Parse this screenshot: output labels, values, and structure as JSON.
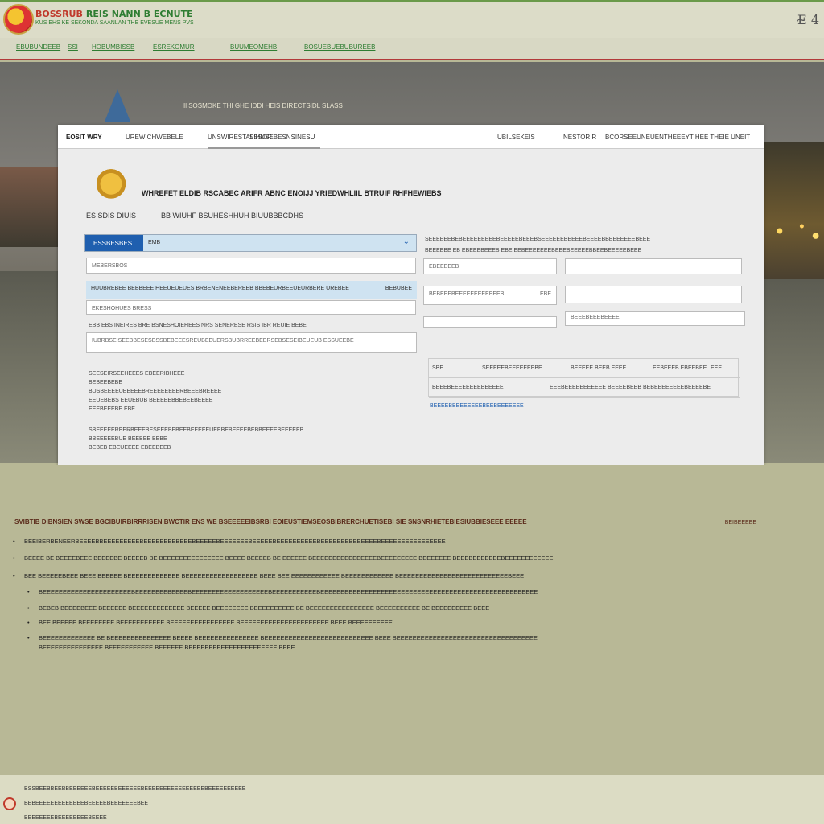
{
  "header": {
    "brand_title_1": "BOSSRUB",
    "brand_title_2": "REIS NANN B ECNUTE",
    "brand_subtitle": "KUS EHS KE SEKONDA SAANLAN THE EVESUE MENS PVS",
    "language_label": "E̴ 4"
  },
  "nav": {
    "items": [
      {
        "label": "EBUBUNDEEB"
      },
      {
        "label": "SSI"
      },
      {
        "label": "HOBUMBISSB"
      },
      {
        "label": "ESREKOMUR"
      },
      {
        "label": "BUUMEOMEHB"
      },
      {
        "label": "BOSUEBUEBUBUREEB"
      }
    ]
  },
  "hero": {
    "caption": "Il SOSMOKE THI GHE IDDI HEIS DIRECTSIDL SLASS"
  },
  "panel": {
    "tabs": [
      {
        "label": "EOSIT WRY"
      },
      {
        "label": "UREWICHWEBELE"
      },
      {
        "label": "UNSWIRESTALSSOR"
      },
      {
        "label": "SIHUSEBESNSINESU"
      },
      {
        "label": "UBILSEKEIS"
      },
      {
        "label": "NESTORIR"
      },
      {
        "label": "BCORSEEUNEUENTHEEEYT HEE THEIE UNEIT"
      }
    ],
    "form_title": "WHREFET ELDIB RSCABEC ARIFR ABNC ENOIJJ YRIEDWHLIIL BTRUIF RHFHEWIEBS",
    "form_ref_1": "ES SDIS DIUIS",
    "form_ref_2": "BB WIUHF BSUHESHHUH BIUUBBBCDHS",
    "select": {
      "tag": "ESSBESBES",
      "value": "EMB",
      "chevron": "⌄"
    },
    "left_input_1": "MEBERSBOS",
    "row_band": "HUUBREBEE BEBBEEE HEEUEUEUES BRBENENEEBEREEB BBEBEURBEEUEURBERE UREBEE",
    "row_band_right": "BEBUBEE",
    "left_input_2": "EKESHOHUES BRESS",
    "note_line": "EBB EBS INEIRES BRE BSNESHOIEHEES NRS SENERESE RSIS IBR REUIE BEBE",
    "left_textarea": "IUBRBSEISEEBBESESESSBEBEEESREUBEEUERSBUBRREEBEERSEBSESEIBEUEUB ESSUEEBE",
    "left_info_1": "SEESEIRSEEHEEES EBEERIBHEEE",
    "left_info_2": "BEBEEBEBE",
    "left_info_3": "BUSBEEEEUEEEEEBREEEEEEEERBEEEBREEEE",
    "left_info_4": "EEUEBEBS EEUEBUB BEEEEEBBEBEEBEEEE",
    "left_info_5": "EEEBEEEBE   EBE",
    "left_footnote_1": "SBEEEEEREERBEEEBESEEEBEBEEBEEEEEUEEBEBEEEEBEBBEEEEBEEEEEB",
    "left_footnote_2": "BBEEEEEBUE BEEBEE BEBE",
    "left_footnote_3": "BEBEB EBEUEEEE EBEEBEEB",
    "right_header": "SEEEEEEBEBEEEEEEEEEBEEEEEBEEEBSEEEEEEBEEEEBEEEEBBEEEEEEEBEEE",
    "right_label_1": "BEEEEBE EB EBEEEBEEEB EBE EEBEEEEEEEBEEEBEEEEEBBEEBEEEEEBEEE",
    "right_input_1": "EBEEEEEB",
    "right_input_2": "",
    "right_input_3": "BEBEEEBEEEEEEEEEEEEB",
    "right_input_3b": "EBE",
    "right_input_4": "",
    "right_input_5": "",
    "right_input_6": "BEEEBEEEBEEEE",
    "table": {
      "rows": [
        {
          "c1": "SBE",
          "c2": "SEEEEEBEEEEEEEBE",
          "c3": "BEEEEE BEEB EEEE",
          "c4": "EEBEEEB   EBEEBEE",
          "c5": "EEE"
        },
        {
          "c1": "BEEEBEEEEEEEEBEEEEE",
          "c2": "",
          "c3": "EEEBEEEEEEEEEEE BEEEEBEEB BEBEEEEEEEEBEEEEBE",
          "c4": "",
          "c5": ""
        }
      ]
    },
    "right_link": "BEEEEBBEEEEEEEBEEBEEEEEEE"
  },
  "content": {
    "section_title": "SVIBTIB DIBNSIEN SWSE BGCIBUIRBIRRRISEN BWCTIR ENS WE BSEEEEEIBSRBI EOIEUSTIEMSEOSBIBRERCHUETISEBI SIE SNSNRHIETEBIESIUBBIESEEE EEEEE",
    "section_right": "BEIBEEEEE",
    "bullets": [
      "BEEIBERBENEERBEEEEBBEEEEEEEEEBEEEEEEEEBEEEBEEEEEBEEEEEEEBEEEEEBEEEEEEEEEEBEEEEEEEBEEEEEEBEEEEEEEEEEEEEEEE",
      "BEEEE BE BEEEEBEEE BEEEEBE BEEEEB BE BEEEEEEEEEEEEEEE BEEEE BEEEEB BE EEEEEE BEEEEEEEEEEEEEEEEBEEEEEEEEE BEEEEEEE BEEEBEEEEEEEBEEEEEEEEEEEE",
      "BEE BEEEEEBEEE BEEE BEEEEE BEEEEEEEEEEEEE BEEEEEEEEEEEEEEEEEE BEEE BEE EEEEEEEEEEEE BEEEEEEEEEEEE BEEEEEEEEEEEEEEEEEEEEEEEEEEEBEEE",
      "BEEEEEEEEEEEEEEEEEEEEEEBEEEEEEEEBEEEEBEEEEEEEEEEEEEEEEEEEBEEEEEEEEEEEBEEEEEEEEEEEEEEEEEEEEEEEEEEEEEEEEEEEEEEEEEEEEEEEEEEEEEE",
      "BEBEB BEEEEBEEE BEEEEEE BEEEEEEEEEEEEE BEEEEE BEEEEEEEE BEEEEEEEEEE BE BEEEEEEEEEEEEEEEE BEEEEEEEEEE BE BEEEEEEEEE BEEE",
      "BEE BEEEEE BEEEEEEEE BEEEEEEEEEEE BEEEEEEEEEEEEEEEE BEEEEEEEEEEEEEEEEEEEEEE BEEE BEEEEEEEEEE",
      "BEEEEEEEEEEEEE BE BEEEEEEEEEEEEEEE BEEEE BEEEEEEEEEEEEEEE BEEEEEEEEEEEEEEEEEEEEEEEEEEE BEEE BEEEEEEEEEEEEEEEEEEEEEEEEEEEEEEEEEEE",
      "BEEEEEEEEEEEEEEE BEEEEEEEEEEE BEEEEEE BEEEEEEEEEEEEEEEEEEEEEE BEEE"
    ]
  },
  "footer": {
    "line_1": "BSSBEEBBEEBBEEEEEEBEEEEEBEEEEEEBEEEEEEEEEEEEEEEEBEEEEEEEEEE",
    "line_2": "BEBEEEEEEEEEEEEEBEEEEEBEEEEEEEBEE",
    "line_3": "BEEEEEEEBEEEEEEEEBEEEE"
  }
}
